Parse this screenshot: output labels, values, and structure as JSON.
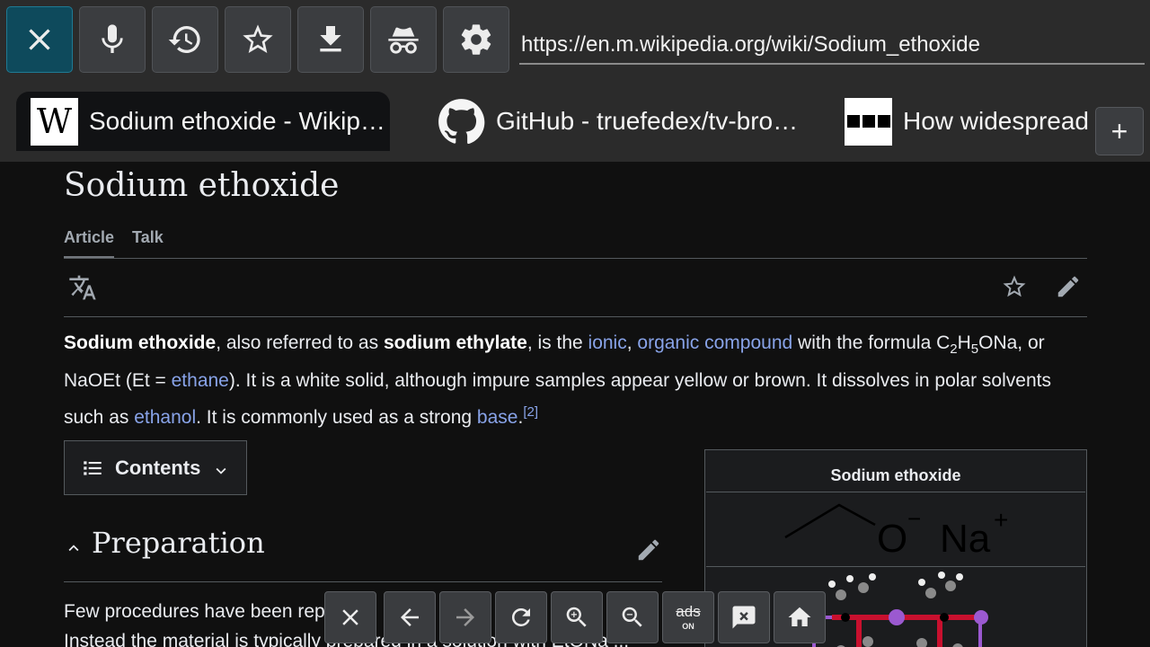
{
  "toolbar": {
    "buttons": [
      {
        "name": "close",
        "icon": "close-icon"
      },
      {
        "name": "voice",
        "icon": "microphone-icon"
      },
      {
        "name": "history",
        "icon": "history-icon"
      },
      {
        "name": "favorites",
        "icon": "star-outline-icon"
      },
      {
        "name": "downloads",
        "icon": "download-icon"
      },
      {
        "name": "incognito",
        "icon": "incognito-icon"
      },
      {
        "name": "settings",
        "icon": "gear-icon"
      }
    ],
    "url": "https://en.m.wikipedia.org/wiki/Sodium_ethoxide"
  },
  "tabs": [
    {
      "title": "Sodium ethoxide - Wikip…",
      "favicon": "wikipedia-logo-icon",
      "active": true
    },
    {
      "title": "GitHub - truefedex/tv-bro…",
      "favicon": "github-logo-icon",
      "active": false
    },
    {
      "title": "How widespread d",
      "favicon": "generic-site-icon",
      "active": false
    }
  ],
  "add_tab_label": "+",
  "article": {
    "title": "Sodium ethoxide",
    "tabs": [
      "Article",
      "Talk"
    ],
    "intro": {
      "b1": "Sodium ethoxide",
      "t1": ", also referred to as ",
      "b2": "sodium ethylate",
      "t2": ", is the ",
      "l1": "ionic",
      "t3": ", ",
      "l2": "organic compound",
      "t4": " with the formula C",
      "s1": "2",
      "t5": "H",
      "s2": "5",
      "t6": "ONa, or NaOEt (Et = ",
      "l3": "ethane",
      "t7": "). It is a white solid, although impure samples appear yellow or brown. It dissolves in polar solvents such as ",
      "l4": "ethanol",
      "t8": ". It is commonly used as a strong ",
      "l5": "base",
      "t9": ".",
      "ref": "[2]"
    },
    "contents_label": "Contents",
    "section_title": "Preparation",
    "section_text_line1": "Few procedures have been repo",
    "section_text_line2": "Instead the material is typically prepared in a solution with EtONa ..."
  },
  "infobox": {
    "title": "Sodium ethoxide",
    "formula_anion": "O",
    "formula_anion_charge": "−",
    "formula_cation": "Na",
    "formula_cation_charge": "+"
  },
  "actionbar": {
    "buttons": [
      {
        "name": "close",
        "icon": "close-icon"
      },
      {
        "name": "back",
        "icon": "arrow-left-icon"
      },
      {
        "name": "forward",
        "icon": "arrow-right-icon"
      },
      {
        "name": "refresh",
        "icon": "refresh-icon"
      },
      {
        "name": "zoom-in",
        "icon": "zoom-in-icon"
      },
      {
        "name": "zoom-out",
        "icon": "zoom-out-icon"
      },
      {
        "name": "adblock",
        "icon": "adblock-icon"
      },
      {
        "name": "feedback",
        "icon": "feedback-icon"
      },
      {
        "name": "home",
        "icon": "home-icon"
      }
    ],
    "ads_text": "ads",
    "ads_state": "ON"
  }
}
